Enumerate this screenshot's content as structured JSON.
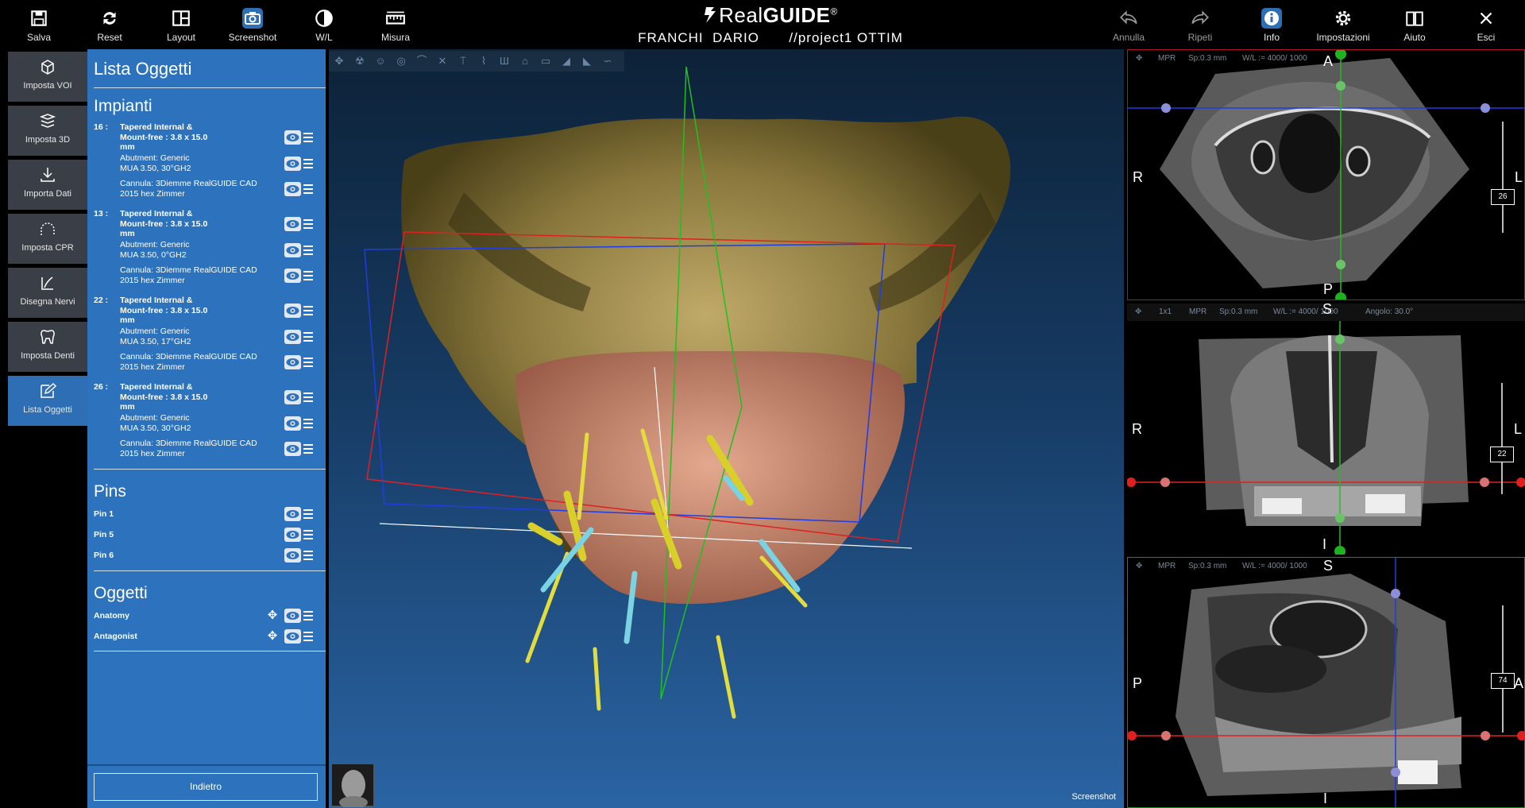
{
  "topbar": {
    "left_buttons": [
      {
        "label": "Salva",
        "icon": "save-icon"
      },
      {
        "label": "Reset",
        "icon": "reset-icon"
      },
      {
        "label": "Layout",
        "icon": "layout-icon"
      },
      {
        "label": "Screenshot",
        "icon": "camera-icon"
      },
      {
        "label": "W/L",
        "icon": "contrast-icon"
      },
      {
        "label": "Misura",
        "icon": "ruler-icon"
      }
    ],
    "brand_light": "Real",
    "brand_bold": "GUIDE",
    "brand_mark": "®",
    "patient": "FRANCHI  DARIO",
    "project": "//project1 OTTIM",
    "right_buttons": [
      {
        "label": "Annulla",
        "icon": "undo-icon"
      },
      {
        "label": "Ripeti",
        "icon": "redo-icon"
      },
      {
        "label": "Info",
        "icon": "info-icon"
      },
      {
        "label": "Impostazioni",
        "icon": "gear-icon"
      },
      {
        "label": "Aiuto",
        "icon": "book-icon"
      },
      {
        "label": "Esci",
        "icon": "close-icon"
      }
    ]
  },
  "rail": [
    {
      "label": "Imposta VOI",
      "icon": "cube-icon"
    },
    {
      "label": "Imposta 3D",
      "icon": "volume-icon"
    },
    {
      "label": "Importa Dati",
      "icon": "import-icon"
    },
    {
      "label": "Imposta CPR",
      "icon": "arch-icon"
    },
    {
      "label": "Disegna Nervi",
      "icon": "nerve-icon"
    },
    {
      "label": "Imposta Denti",
      "icon": "tooth-icon"
    },
    {
      "label": "Lista Oggetti",
      "icon": "edit-list-icon"
    }
  ],
  "panel": {
    "title": "Lista Oggetti",
    "implants_title": "Impianti",
    "implants": [
      {
        "num": "16 :",
        "name": [
          "Tapered Internal &",
          "Mount-free : 3.8 x 15.0",
          "mm"
        ],
        "abutment": [
          "Abutment: Generic",
          "MUA 3.50, 30°GH2"
        ],
        "cannula": [
          "Cannula: 3Diemme RealGUIDE CAD",
          "2015 hex Zimmer"
        ]
      },
      {
        "num": "13 :",
        "name": [
          "Tapered Internal &",
          "Mount-free : 3.8 x 15.0",
          "mm"
        ],
        "abutment": [
          "Abutment: Generic",
          "MUA 3.50, 0°GH2"
        ],
        "cannula": [
          "Cannula: 3Diemme RealGUIDE CAD",
          "2015 hex Zimmer"
        ]
      },
      {
        "num": "22 :",
        "name": [
          "Tapered Internal &",
          "Mount-free : 3.8 x 15.0",
          "mm"
        ],
        "abutment": [
          "Abutment: Generic",
          "MUA 3.50, 17°GH2"
        ],
        "cannula": [
          "Cannula: 3Diemme RealGUIDE CAD",
          "2015 hex Zimmer"
        ]
      },
      {
        "num": "26 :",
        "name": [
          "Tapered Internal &",
          "Mount-free : 3.8 x 15.0",
          "mm"
        ],
        "abutment": [
          "Abutment: Generic",
          "MUA 3.50, 30°GH2"
        ],
        "cannula": [
          "Cannula: 3Diemme RealGUIDE CAD",
          "2015 hex Zimmer"
        ]
      }
    ],
    "pins_title": "Pins",
    "pins": [
      "Pin 1",
      "Pin 5",
      "Pin 6"
    ],
    "objects_title": "Oggetti",
    "objects": [
      "Anatomy",
      "Antagonist"
    ],
    "back_label": "Indietro"
  },
  "view3d": {
    "label": "Screenshot",
    "toolbar_icons": [
      "move-icon",
      "radiation-icon",
      "skull-icon",
      "face-icon",
      "tooth-icon",
      "close-icon",
      "implant-icon",
      "nerve-icon",
      "teeth-icon",
      "jaw-icon",
      "scan-icon",
      "guide-icon",
      "guide2-icon",
      "curve-icon"
    ]
  },
  "mpr": [
    {
      "bar": [
        "MPR",
        "Sp:0.3 mm",
        "W/L := 4000/ 1000"
      ],
      "orient": {
        "top": "A",
        "bottom": "P",
        "left": "R",
        "right": "L"
      },
      "slice": "26"
    },
    {
      "bar": [
        "1x1",
        "MPR",
        "Sp:0.3 mm",
        "W/L := 4000/ 1000",
        "Angolo: 30.0°"
      ],
      "orient": {
        "top": "S",
        "bottom": "I",
        "left": "R",
        "right": "L"
      },
      "slice": "22"
    },
    {
      "bar": [
        "MPR",
        "Sp:0.3 mm",
        "W/L := 4000/ 1000"
      ],
      "orient": {
        "top": "S",
        "bottom": "I",
        "left": "P",
        "right": "A"
      },
      "slice": "74"
    }
  ],
  "colors": {
    "panel_blue": "#2c72bd",
    "rail_active": "#2d6eb4",
    "rail_bg": "#3a3f47",
    "axis_red": "#e02020",
    "axis_green": "#20c020",
    "axis_blue": "#1f3de0"
  }
}
